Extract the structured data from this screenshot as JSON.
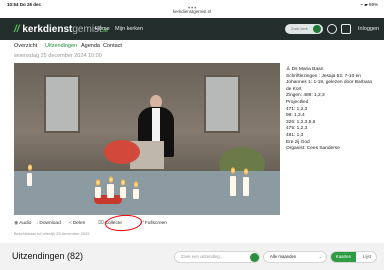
{
  "status": {
    "time": "10:54 Do 26 dec",
    "battery": "69%"
  },
  "browser": {
    "url": "kerkdienstgemist.nl"
  },
  "header": {
    "brand": "kerkdienst",
    "brand_suffix": "gemist",
    "brand_tld": ".nl",
    "nav": [
      "Home",
      "Mijn kerken"
    ],
    "search_placeholder": "Zoek kerk",
    "login": "Inloggen"
  },
  "tabs": [
    "Overzicht",
    "Uitzendingen",
    "Agenda",
    "Contact"
  ],
  "active_tab": "Uitzendingen",
  "broadcast": {
    "date": "woensdag 25 december 2024 10:00",
    "available_until": "Beschikbaar tot uiterlijk 25 december 2025"
  },
  "actions": [
    {
      "icon": "audio-icon",
      "label": "Audio"
    },
    {
      "icon": "download-icon",
      "label": "Download"
    },
    {
      "icon": "share-icon",
      "label": "Delen"
    },
    {
      "icon": "collect-icon",
      "label": "Collecte"
    },
    {
      "icon": "fullscreen-icon",
      "label": "Fullscreen"
    }
  ],
  "service_info": [
    "Ds Maria Baan",
    "Schriftlezingen : Jesaja 52: 7-10 en Johannes 1: 1-18, gelezen door Barbara de Kort",
    "Zingen: 489: 1,2,3",
    "Projectlied",
    "471: 1,2,3",
    "98: 1,3,4",
    "326: 1,2,3,5,6",
    "475: 1,2,3",
    "481: 1,3",
    "Ere zij God",
    "Organist: Cees Sanderse"
  ],
  "uitzendingen": {
    "heading": "Uitzendingen (82)",
    "search_placeholder": "Zoek een uitzending...",
    "filter_value": "Alle maanden",
    "view_options": [
      "Kaarten",
      "Lijst"
    ]
  },
  "colors": {
    "brand_green": "#5fc25f",
    "nav_background": "#222d2c",
    "active_tab": "#1d8a34",
    "toggle_green": "#2e9d42",
    "annotation_red": "#e00000"
  }
}
